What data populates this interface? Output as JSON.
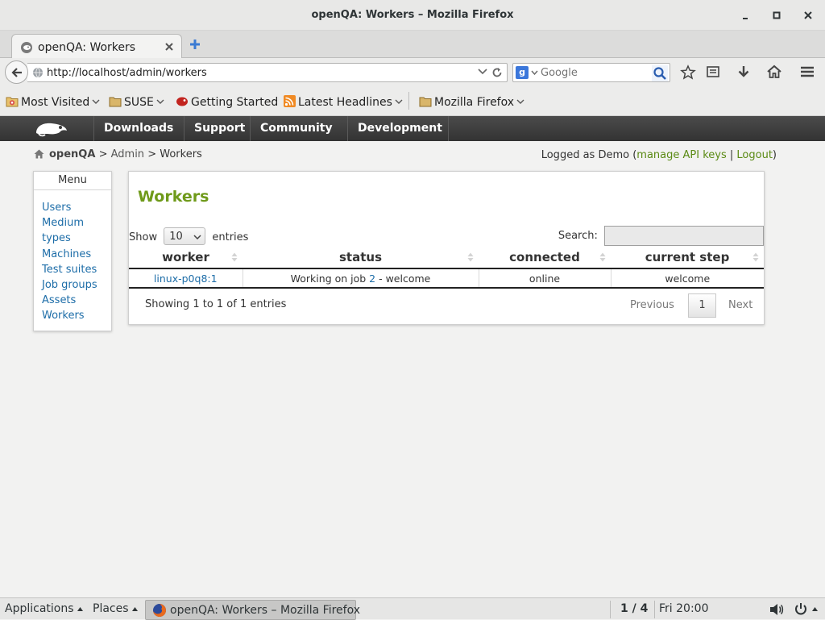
{
  "window": {
    "title": "openQA: Workers – Mozilla Firefox"
  },
  "tab": {
    "label": "openQA: Workers"
  },
  "toolbar": {
    "url": "http://localhost/admin/workers",
    "search_placeholder": "Google"
  },
  "bookmarks": {
    "items": [
      {
        "label": "Most Visited",
        "icon": "most-visited-folder-icon",
        "dropdown": true
      },
      {
        "label": "SUSE",
        "icon": "folder-icon",
        "dropdown": true
      },
      {
        "label": "Getting Started",
        "icon": "suse-chameleon-icon",
        "dropdown": false
      },
      {
        "label": "Latest Headlines",
        "icon": "rss-feed-icon",
        "dropdown": true
      },
      {
        "label": "Mozilla Firefox",
        "icon": "folder-icon",
        "dropdown": true
      }
    ]
  },
  "sitenav": {
    "items": [
      {
        "label": "Downloads"
      },
      {
        "label": "Support"
      },
      {
        "label": "Community"
      },
      {
        "label": "Development"
      }
    ]
  },
  "breadcrumb": {
    "root": "openQA",
    "sep": ">",
    "admin": "Admin",
    "current": "Workers"
  },
  "login": {
    "prefix": "Logged as Demo (",
    "api_keys": "manage API keys",
    "divider": "|",
    "logout": "Logout",
    "suffix": ")"
  },
  "menu": {
    "title": "Menu",
    "items": [
      {
        "label": "Users"
      },
      {
        "label": "Medium"
      },
      {
        "label": "types"
      },
      {
        "label": "Machines"
      },
      {
        "label": "Test suites"
      },
      {
        "label": "Job groups"
      },
      {
        "label": "Assets"
      },
      {
        "label": "Workers"
      }
    ]
  },
  "workers": {
    "heading": "Workers",
    "show_label": "Show",
    "entries_value": "10",
    "entries_label": "entries",
    "search_label": "Search:",
    "columns": [
      "worker",
      "status",
      "connected",
      "current step"
    ],
    "rows": [
      {
        "worker": "linux-p0q8:1",
        "status_prefix": "Working on job ",
        "job": "2",
        "status_suffix": " - welcome",
        "connected": "online",
        "current_step": "welcome"
      }
    ],
    "info": "Showing 1 to 1 of 1 entries",
    "pager": {
      "previous": "Previous",
      "page": "1",
      "next": "Next"
    }
  },
  "taskbar": {
    "applications": "Applications",
    "places": "Places",
    "window": "openQA: Workers – Mozilla Firefox",
    "workspace": "1 / 4",
    "clock": "Fri 20:00"
  },
  "colors": {
    "heading_green": "#6f9a1a",
    "link_blue": "#1d6da8",
    "login_link_green": "#5a8a14",
    "navbar_dark": "#3c3c3c"
  }
}
